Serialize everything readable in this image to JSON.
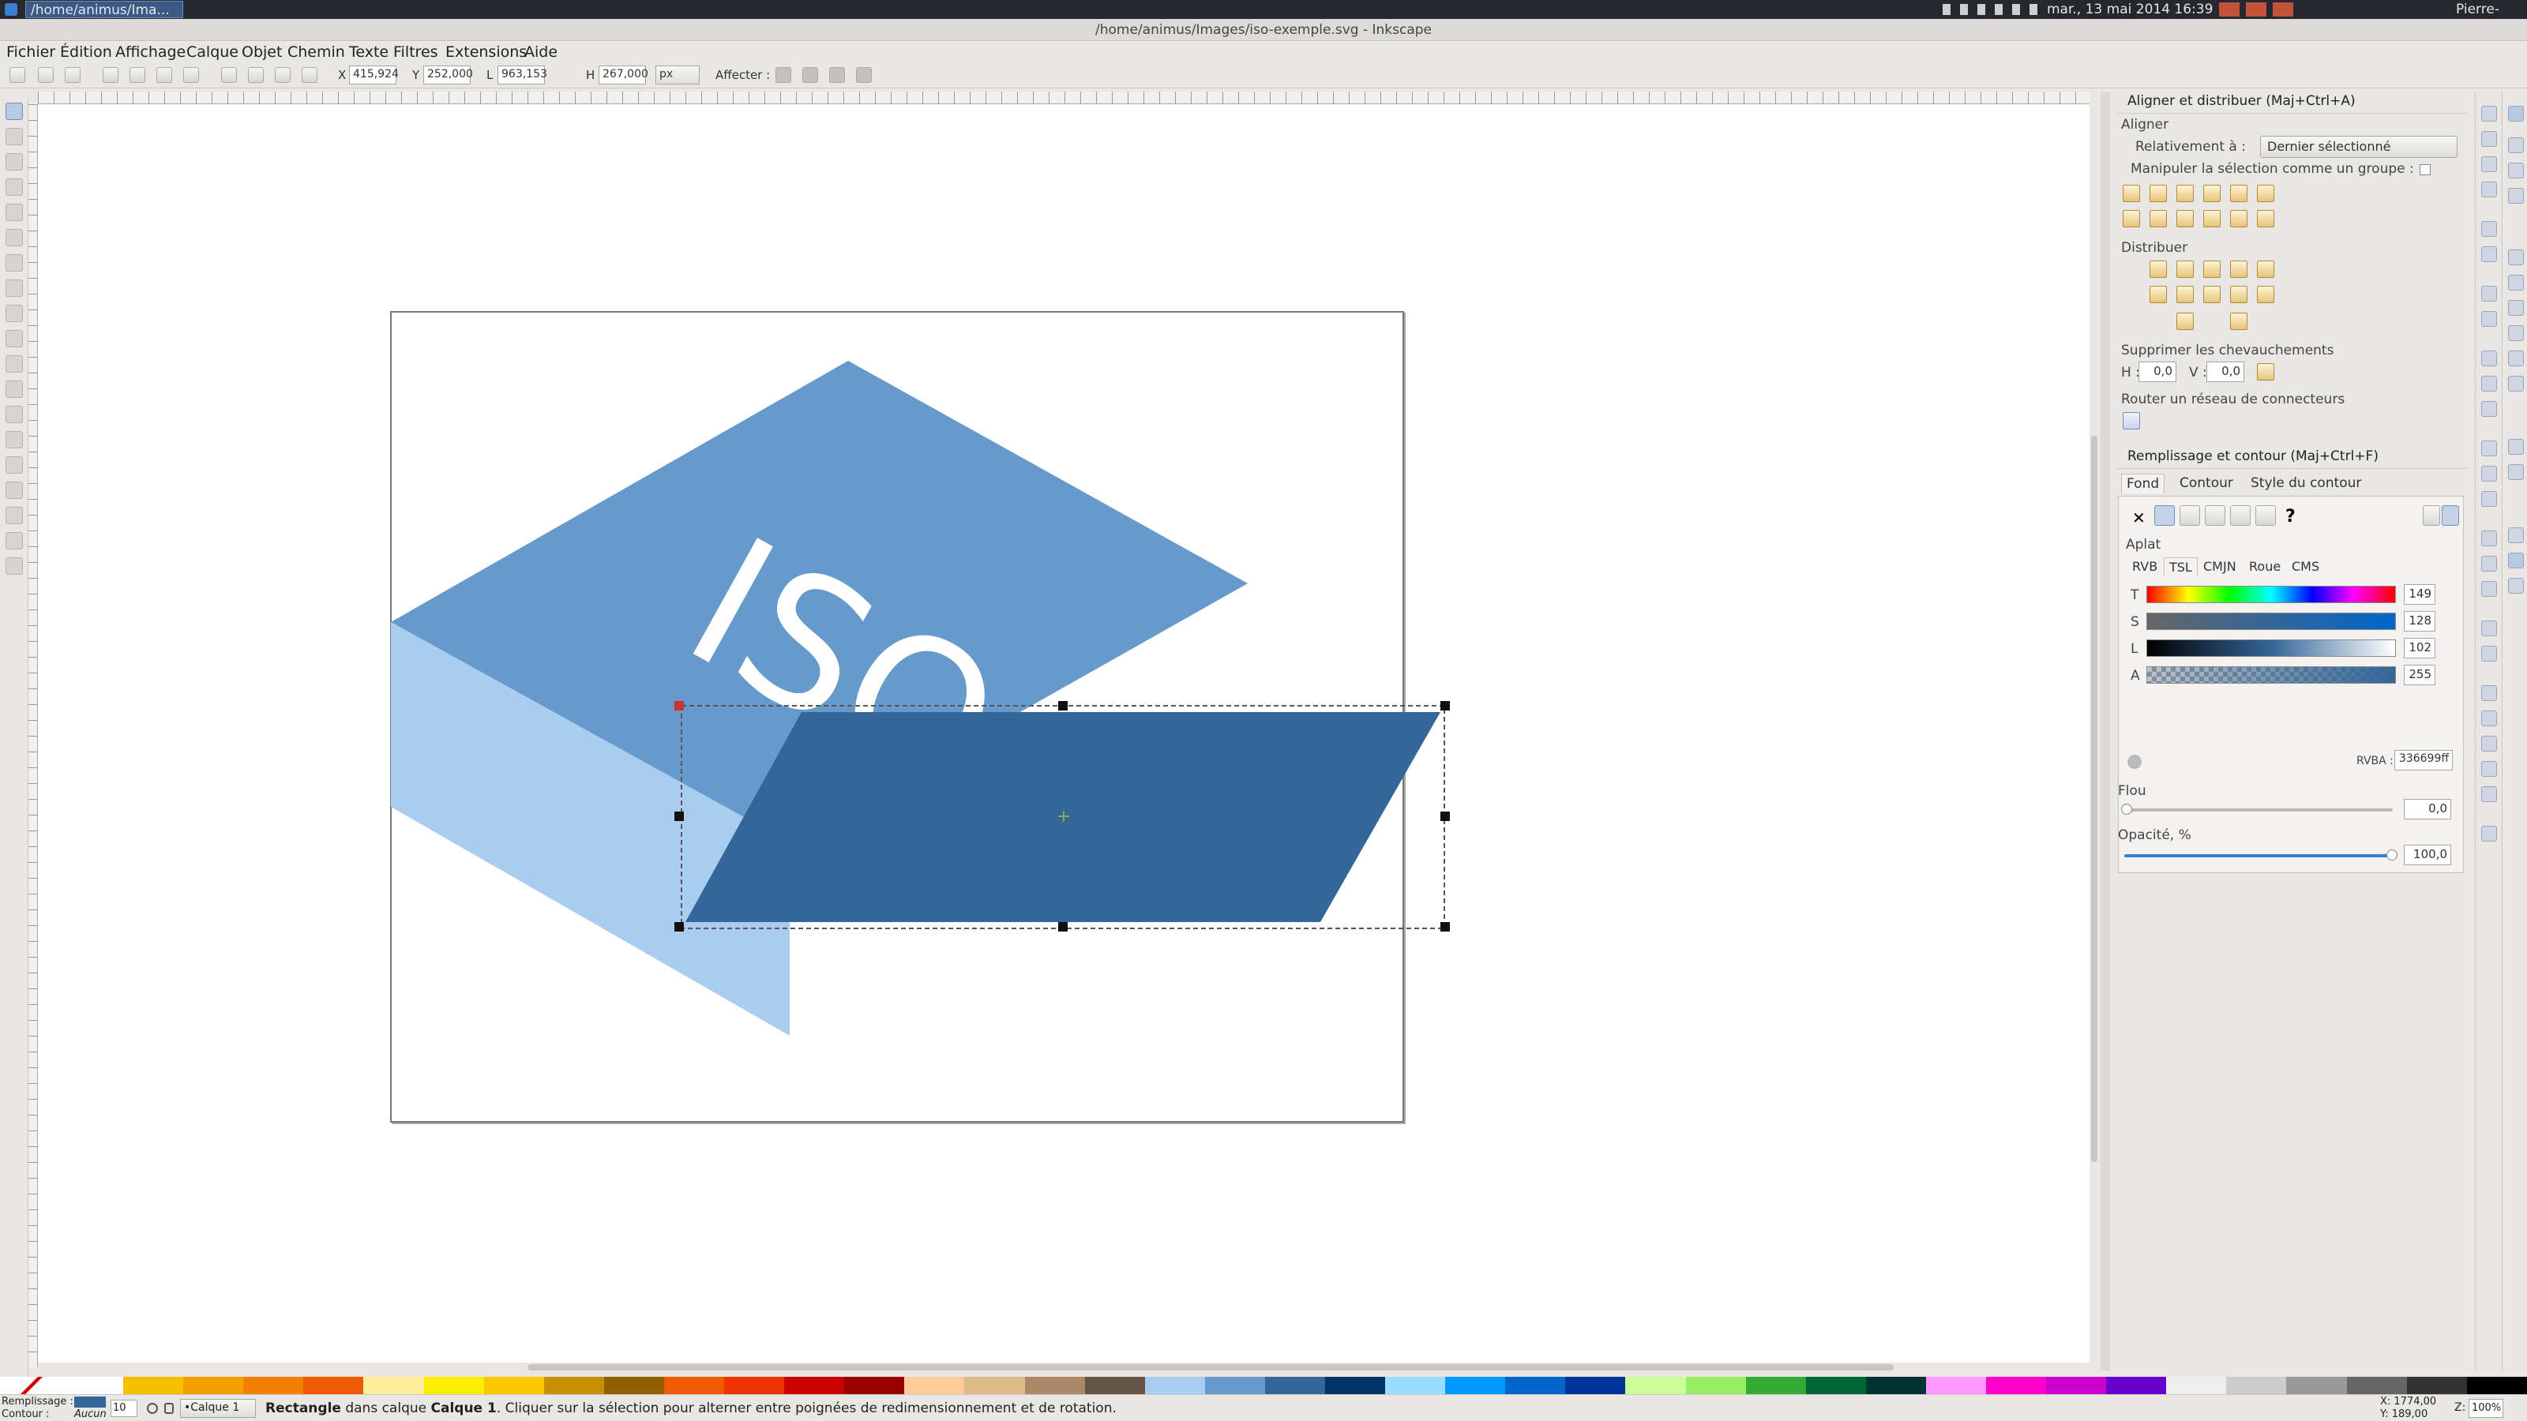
{
  "panel": {
    "task_title": "/home/animus/Ima...",
    "clock": "mar., 13 mai 2014 16:39",
    "user": "Pierre-Jean"
  },
  "window": {
    "title": "/home/animus/Images/iso-exemple.svg - Inkscape"
  },
  "menu": [
    "Fichier",
    "Édition",
    "Affichage",
    "Calque",
    "Objet",
    "Chemin",
    "Texte",
    "Filtres",
    "Extensions",
    "Aide"
  ],
  "toolbar": {
    "x_label": "X",
    "x_value": "415,924",
    "y_label": "Y",
    "y_value": "252,000",
    "w_label": "L",
    "w_value": "963,153",
    "h_label": "H",
    "h_value": "267,000",
    "unit": "px",
    "affect_label": "Affecter :"
  },
  "canvas": {
    "artwork_text": "ISO",
    "colors": {
      "top_face": "#6699cc",
      "side_face": "#aaccee",
      "selected_shape": "#336699"
    }
  },
  "align_panel": {
    "title": "Aligner et distribuer (Maj+Ctrl+A)",
    "align_header": "Aligner",
    "relative_label": "Relativement à :",
    "relative_value": "Dernier sélectionné",
    "group_label": "Manipuler la sélection comme un groupe :",
    "distribute_header": "Distribuer",
    "overlap_header": "Supprimer les chevauchements",
    "h_label": "H :",
    "h_value": "0,0",
    "v_label": "V :",
    "v_value": "0,0",
    "connector_header": "Router un réseau de connecteurs"
  },
  "fill_panel": {
    "title": "Remplissage et contour (Maj+Ctrl+F)",
    "tabs": [
      "Fond",
      "Contour",
      "Style du contour"
    ],
    "paint_x": "✕",
    "paint_unknown": "?",
    "flat_label": "Aplat",
    "mode_tabs": [
      "RVB",
      "TSL",
      "CMJN",
      "Roue",
      "CMS"
    ],
    "channels": [
      {
        "label": "T",
        "value": "149"
      },
      {
        "label": "S",
        "value": "128"
      },
      {
        "label": "L",
        "value": "102"
      },
      {
        "label": "A",
        "value": "255"
      }
    ],
    "rgba_label": "RVBA :",
    "rgba_value": "336699ff",
    "blur_label": "Flou",
    "blur_value": "0,0",
    "opacity_label": "Opacité, %",
    "opacity_value": "100,0"
  },
  "palette": [
    "#ffffff",
    "#f6c000",
    "#f6a000",
    "#f28000",
    "#ee5a00",
    "#ffee99",
    "#ffee00",
    "#f9c800",
    "#c89000",
    "#906000",
    "#f25a00",
    "#ee3300",
    "#cc0000",
    "#990000",
    "#ffcc99",
    "#ddbb88",
    "#aa8866",
    "#665544",
    "#aaccee",
    "#6699cc",
    "#336699",
    "#003366",
    "#99ddff",
    "#0099ff",
    "#0066cc",
    "#003399",
    "#ccff99",
    "#99ee66",
    "#33aa33",
    "#006633",
    "#003333",
    "#ff99ff",
    "#ff00cc",
    "#cc00cc",
    "#6600cc",
    "#eeeeee",
    "#cccccc",
    "#999999",
    "#666666",
    "#333333",
    "#000000"
  ],
  "status": {
    "fill_label": "Remplissage :",
    "stroke_label": "Contour :",
    "stroke_value": "Aucun",
    "opacity_value": "10",
    "layer_value": "•Calque 1",
    "message_bold": "Rectangle",
    "message_mid": " dans calque ",
    "message_layer": "Calque 1",
    "message_rest": ". Cliquer sur la sélection pour alterner entre poignées de redimensionnement et de rotation.",
    "x_readout": "X: 1774,00",
    "y_readout": "Y: 189,00",
    "zoom_label": "Z:",
    "zoom_value": "100%"
  }
}
